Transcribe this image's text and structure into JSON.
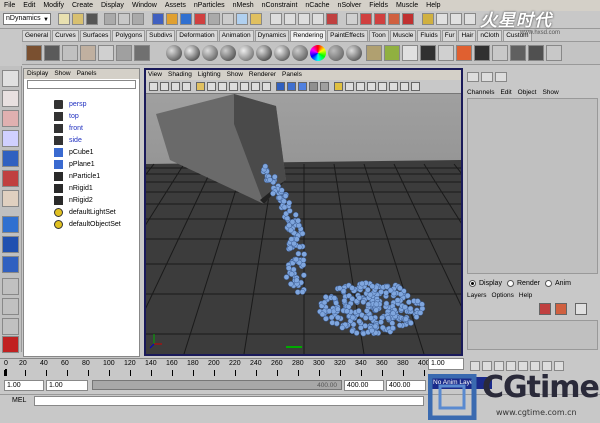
{
  "menubar": [
    "File",
    "Edit",
    "Modify",
    "Create",
    "Display",
    "Window",
    "Assets",
    "nParticles",
    "nMesh",
    "nConstraint",
    "nCache",
    "nSolver",
    "Fields",
    "Muscle",
    "Help"
  ],
  "statusline": {
    "mode": "nDynamics"
  },
  "shelf": {
    "tabs": [
      "General",
      "Curves",
      "Surfaces",
      "Polygons",
      "Subdivs",
      "Deformation",
      "Animation",
      "Dynamics",
      "Rendering",
      "PaintEffects",
      "Toon",
      "Muscle",
      "Fluids",
      "Fur",
      "Hair",
      "nCloth",
      "Custom"
    ],
    "active_tab": "Rendering"
  },
  "outliner": {
    "menus": [
      "Display",
      "Show",
      "Panels"
    ],
    "items": [
      {
        "label": "persp",
        "kind": "camera"
      },
      {
        "label": "top",
        "kind": "camera"
      },
      {
        "label": "front",
        "kind": "camera"
      },
      {
        "label": "side",
        "kind": "camera"
      },
      {
        "label": "pCube1",
        "kind": "mesh"
      },
      {
        "label": "pPlane1",
        "kind": "mesh"
      },
      {
        "label": "nParticle1",
        "kind": "particle"
      },
      {
        "label": "nRigid1",
        "kind": "rigid"
      },
      {
        "label": "nRigid2",
        "kind": "rigid"
      },
      {
        "label": "defaultLightSet",
        "kind": "set"
      },
      {
        "label": "defaultObjectSet",
        "kind": "set"
      }
    ]
  },
  "viewport": {
    "menus": [
      "View",
      "Shading",
      "Lighting",
      "Show",
      "Renderer",
      "Panels"
    ]
  },
  "channelbox": {
    "menus": [
      "Channels",
      "Edit",
      "Object",
      "Show"
    ]
  },
  "layereditor": {
    "modes": [
      "Display",
      "Render",
      "Anim"
    ],
    "selected_mode": "Display",
    "menus": [
      "Layers",
      "Options",
      "Help"
    ]
  },
  "timeslider": {
    "ticks": [
      "0",
      "20",
      "40",
      "60",
      "80",
      "100",
      "120",
      "140",
      "160",
      "180",
      "200",
      "220",
      "240",
      "260",
      "280",
      "300",
      "320",
      "340",
      "360",
      "380",
      "400"
    ],
    "current_frame": "1.00"
  },
  "rangeslider": {
    "start": "1.00",
    "start_range": "1.00",
    "end_range_label": "400.00",
    "end_range": "400.00",
    "end": "400.00",
    "anim_layer": "No Anim Layer"
  },
  "cmdline": {
    "label": "MEL"
  },
  "watermark": {
    "top": "火星时代",
    "top_sub": "www.hxsd.com",
    "brand": "CGtime",
    "url": "www.cgtime.com.cn"
  },
  "colors": {
    "particle": "#7fa6de",
    "viewport_border": "#1a1a5a",
    "anim_layer_bg": "#1a2a8a"
  }
}
